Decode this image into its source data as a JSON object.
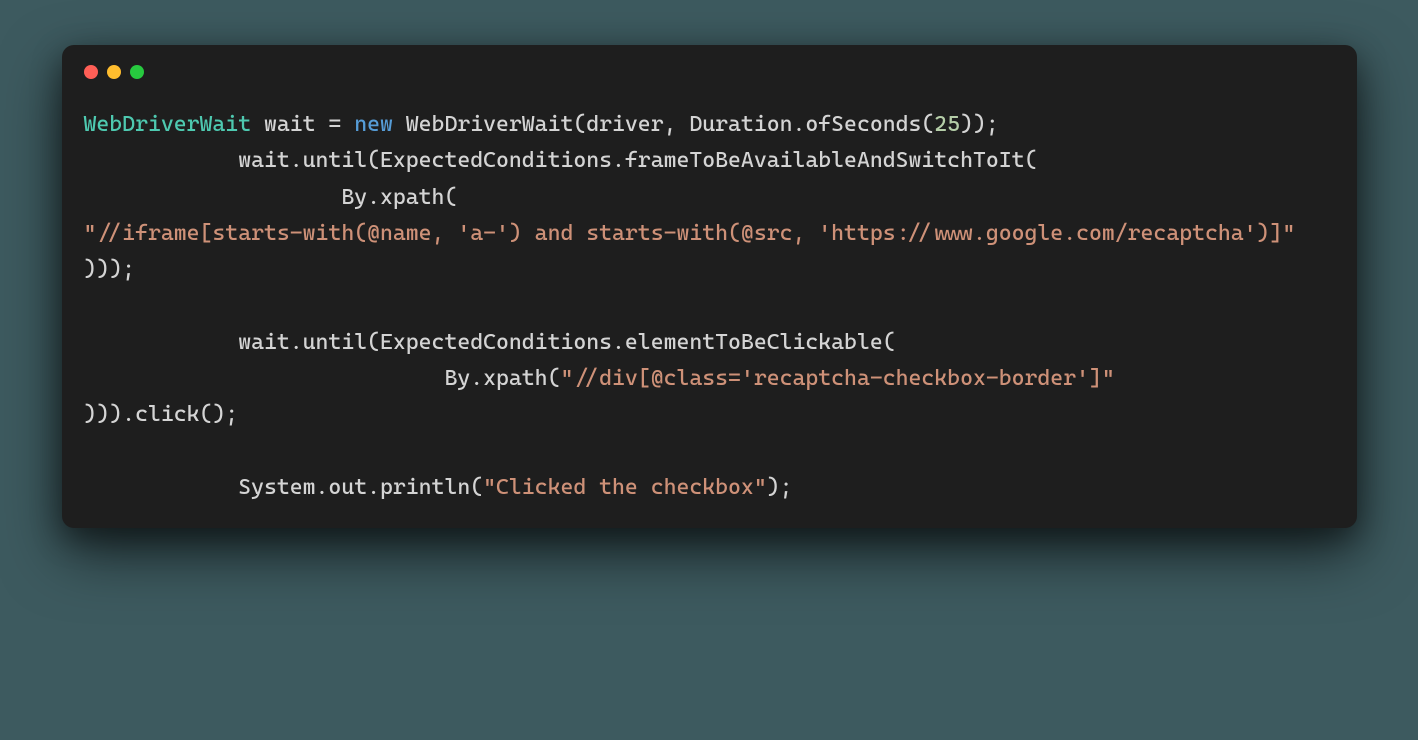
{
  "code": {
    "tokens": [
      {
        "cls": "tok-type",
        "t": "WebDriverWait"
      },
      {
        "cls": "tok-ident",
        "t": " wait = "
      },
      {
        "cls": "tok-keyword",
        "t": "new"
      },
      {
        "cls": "tok-ident",
        "t": " WebDriverWait(driver, Duration.ofSeconds("
      },
      {
        "cls": "tok-number",
        "t": "25"
      },
      {
        "cls": "tok-ident",
        "t": "));\n            wait.until(ExpectedConditions.frameToBeAvailableAndSwitchToIt(\n                    By.xpath(\n"
      },
      {
        "cls": "tok-string",
        "t": "\"//iframe[starts-with(@name, 'a-') and starts-with(@src, 'https://www.google.com/recaptcha')]\""
      },
      {
        "cls": "tok-ident",
        "t": "\n)));\n\n            wait.until(ExpectedConditions.elementToBeClickable(\n                            By.xpath("
      },
      {
        "cls": "tok-string",
        "t": "\"//div[@class='recaptcha-checkbox-border']\""
      },
      {
        "cls": "tok-ident",
        "t": "\n))).click();\n\n            System.out.println("
      },
      {
        "cls": "tok-string",
        "t": "\"Clicked the checkbox\""
      },
      {
        "cls": "tok-ident",
        "t": ");"
      }
    ]
  },
  "traffic_lights": [
    "red",
    "yellow",
    "green"
  ]
}
